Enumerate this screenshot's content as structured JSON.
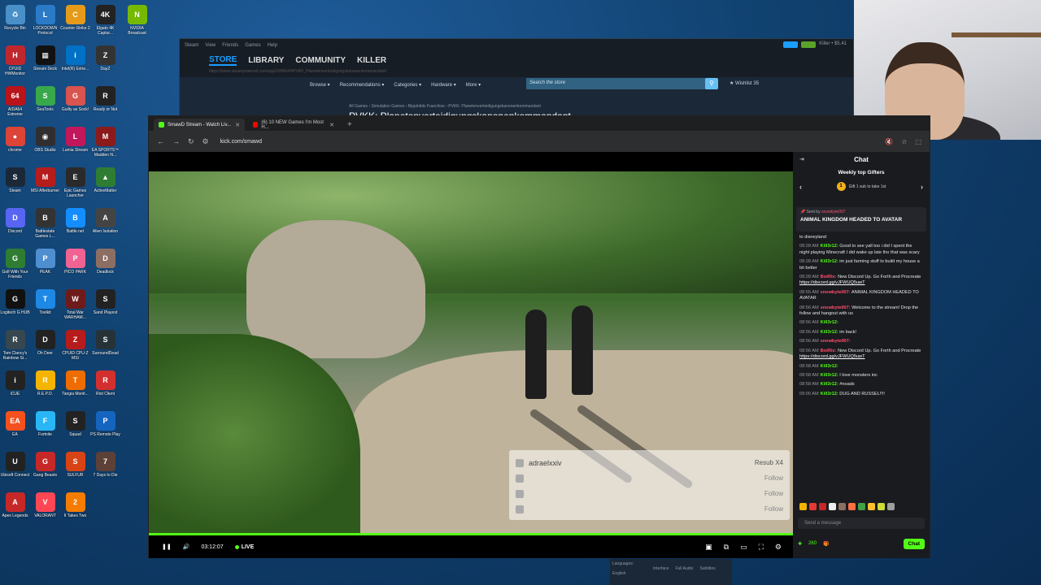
{
  "desktop": {
    "icons": [
      {
        "label": "Recycle Bin",
        "color": "#4a90c8",
        "glyph": "♻"
      },
      {
        "label": "LOCKDOWN Protocol",
        "color": "#2a7ac8",
        "glyph": "L"
      },
      {
        "label": "Counter-Strike 2",
        "color": "#e59a1a",
        "glyph": "C"
      },
      {
        "label": "Elgato 4K Captur...",
        "color": "#222222",
        "glyph": "4K"
      },
      {
        "label": "NVIDIA Broadcast",
        "color": "#76b900",
        "glyph": "N"
      },
      {
        "label": "CPUID HWMonitor",
        "color": "#c0272d",
        "glyph": "H"
      },
      {
        "label": "Stream Deck",
        "color": "#111111",
        "glyph": "▦"
      },
      {
        "label": "Intel(R) Extre...",
        "color": "#0071c5",
        "glyph": "i"
      },
      {
        "label": "DayZ",
        "color": "#333333",
        "glyph": "Z"
      },
      {
        "label": "AIDA64 Extreme",
        "color": "#b8141a",
        "glyph": "64"
      },
      {
        "label": "SeaTools",
        "color": "#38a84a",
        "glyph": "S"
      },
      {
        "label": "Guilty as Sock!",
        "color": "#d9534f",
        "glyph": "G"
      },
      {
        "label": "Ready or Not",
        "color": "#222222",
        "glyph": "R"
      },
      {
        "label": "chrome",
        "color": "#db4437",
        "glyph": "●"
      },
      {
        "label": "OBS Studio",
        "color": "#302e31",
        "glyph": "◉"
      },
      {
        "label": "Lumia Stream",
        "color": "#c2185b",
        "glyph": "L"
      },
      {
        "label": "EA SPORTS™ Madden N...",
        "color": "#8b1a1a",
        "glyph": "M"
      },
      {
        "label": "Steam",
        "color": "#1b2838",
        "glyph": "S"
      },
      {
        "label": "MSI Afterburner",
        "color": "#b71c1c",
        "glyph": "M"
      },
      {
        "label": "Epic Games Launcher",
        "color": "#2a2a2a",
        "glyph": "E"
      },
      {
        "label": "ActiveMatter",
        "color": "#2e7d32",
        "glyph": "▲"
      },
      {
        "label": "Discord",
        "color": "#5865f2",
        "glyph": "D"
      },
      {
        "label": "Battlestate Games L...",
        "color": "#333333",
        "glyph": "B"
      },
      {
        "label": "Battle.net",
        "color": "#148eff",
        "glyph": "B"
      },
      {
        "label": "Alien Isolation",
        "color": "#444444",
        "glyph": "A"
      },
      {
        "label": "Golf With Your Friends",
        "color": "#2e7d32",
        "glyph": "G"
      },
      {
        "label": "PEAK",
        "color": "#4f8fd0",
        "glyph": "P"
      },
      {
        "label": "PICO PARK",
        "color": "#f06292",
        "glyph": "P"
      },
      {
        "label": "Deadlock",
        "color": "#8d6e63",
        "glyph": "D"
      },
      {
        "label": "Logitech G HUB",
        "color": "#111111",
        "glyph": "G"
      },
      {
        "label": "Toolkit",
        "color": "#1e88e5",
        "glyph": "T"
      },
      {
        "label": "Total War WARHAM...",
        "color": "#6d1b1b",
        "glyph": "W"
      },
      {
        "label": "Sand Playest",
        "color": "#222222",
        "glyph": "S"
      },
      {
        "label": "Tom Clancy's Rainbow Si...",
        "color": "#37474f",
        "glyph": "R"
      },
      {
        "label": "Oh Deer",
        "color": "#222222",
        "glyph": "D"
      },
      {
        "label": "CPUID CPU-Z MSI",
        "color": "#b71c1c",
        "glyph": "Z"
      },
      {
        "label": "SurroundDead",
        "color": "#263238",
        "glyph": "S"
      },
      {
        "label": "iCUE",
        "color": "#222222",
        "glyph": "i"
      },
      {
        "label": "R.E.P.O.",
        "color": "#f4b400",
        "glyph": "R"
      },
      {
        "label": "Tangia Monit...",
        "color": "#ef6c00",
        "glyph": "T"
      },
      {
        "label": "Riot Client",
        "color": "#d32f2f",
        "glyph": "R"
      },
      {
        "label": "EA",
        "color": "#f4511e",
        "glyph": "EA"
      },
      {
        "label": "Fortnite",
        "color": "#29b6f6",
        "glyph": "F"
      },
      {
        "label": "Squad",
        "color": "#222222",
        "glyph": "S"
      },
      {
        "label": "PS Remote Play",
        "color": "#1565c0",
        "glyph": "P"
      },
      {
        "label": "Ubisoft Connect",
        "color": "#222222",
        "glyph": "U"
      },
      {
        "label": "Gang Beasts",
        "color": "#c62828",
        "glyph": "G"
      },
      {
        "label": "SULFUR",
        "color": "#d84315",
        "glyph": "S"
      },
      {
        "label": "7 Days to Die",
        "color": "#5d4037",
        "glyph": "7"
      },
      {
        "label": "Apex Legends",
        "color": "#c62828",
        "glyph": "A"
      },
      {
        "label": "VALORANT",
        "color": "#ff4655",
        "glyph": "V"
      },
      {
        "label": "It Takes Two",
        "color": "#f57c00",
        "glyph": "2"
      }
    ]
  },
  "steam": {
    "menu": [
      "Steam",
      "View",
      "Friends",
      "Games",
      "Help"
    ],
    "nav": [
      "STORE",
      "LIBRARY",
      "COMMUNITY",
      "KILLER"
    ],
    "url": "https://store.steampowered.com/app/2956040/PVKK_Planetenverteidigungskanonenkommandant/",
    "store_menu": [
      "Browse ▾",
      "Recommendations ▾",
      "Categories ▾",
      "Hardware ▾",
      "More ▾"
    ],
    "search_placeholder": "Search the store",
    "wishlist": "Wishlist 35",
    "breadcrumb": "All Games › Simulation Games › Bippinbits Franchise › PVKK: Planetenverteidigungskanonenkommandant",
    "game_title": "PVKK: Planetenverteidigungskanonenkommandant",
    "user": "Killer • $5.41"
  },
  "browser": {
    "tabs": [
      {
        "label": "SmawD Stream - Watch Liv...",
        "favicon_color": "#53fc18"
      },
      {
        "label": "(6) 10 NEW Games I'm Most H...",
        "favicon_color": "#ff0000"
      }
    ],
    "url": "kick.com/smawd"
  },
  "player": {
    "time": "03:12:07",
    "live_label": "LIVE",
    "overlay": {
      "top_user": "adraelxxiv",
      "top_action": "Resub X4",
      "rows": [
        {
          "name": "",
          "action": "Follow"
        },
        {
          "name": "",
          "action": "Follow"
        },
        {
          "name": "",
          "action": "Follow"
        }
      ]
    }
  },
  "chat": {
    "title": "Chat",
    "top_gifters_title": "Weekly top Gifters",
    "gift_prompt": "Gift 1 sub to take 1st",
    "pinned_by": "Sent by",
    "pinned_user": "snowbyte007",
    "pinned_message": "ANIMAL KINGDOM HEADED TO AVATAR",
    "partial_line": "to disneyland",
    "messages": [
      {
        "time": "08:28 AM",
        "user": "Kill3r12:",
        "user_color": "#53fc18",
        "text": "Good to see yall too i did I spent the night playing Minecraft I did wake up late tho that was scary",
        "link": ""
      },
      {
        "time": "08:28 AM",
        "user": "Kill3r12:",
        "user_color": "#53fc18",
        "text": "im just farming stuff to build my house a bit better",
        "link": ""
      },
      {
        "time": "08:28 AM",
        "user": "BotRix:",
        "user_color": "#ff4f6e",
        "text": "New Discord Up. Go Forth and Procreate",
        "link": "https://discord.gg/vJFWUQ5uwT"
      },
      {
        "time": "08:55 AM",
        "user": "snowbyte007:",
        "user_color": "#ff4f6e",
        "text": "ANIMAL KINGDOM HEADED TO AVATAR",
        "link": ""
      },
      {
        "time": "08:56 AM",
        "user": "snowbyte007:",
        "user_color": "#ff4f6e",
        "text": "Welcome to the stream! Drop the follow and hangout with us",
        "link": ""
      },
      {
        "time": "08:56 AM",
        "user": "Kill3r12:",
        "user_color": "#53fc18",
        "text": "",
        "link": ""
      },
      {
        "time": "08:56 AM",
        "user": "Kill3r12:",
        "user_color": "#53fc18",
        "text": "im back!",
        "link": ""
      },
      {
        "time": "08:56 AM",
        "user": "snowbyte007:",
        "user_color": "#ff4f6e",
        "text": "",
        "link": ""
      },
      {
        "time": "08:56 AM",
        "user": "BotRix:",
        "user_color": "#ff4f6e",
        "text": "New Discord Up. Go Forth and Procreate",
        "link": "https://discord.gg/vJFWUQ5uwT"
      },
      {
        "time": "08:58 AM",
        "user": "Kill3r12:",
        "user_color": "#53fc18",
        "text": "",
        "link": ""
      },
      {
        "time": "08:58 AM",
        "user": "Kill3r12:",
        "user_color": "#53fc18",
        "text": "I love monsters inc",
        "link": ""
      },
      {
        "time": "08:58 AM",
        "user": "Kill3r12:",
        "user_color": "#53fc18",
        "text": "#noads",
        "link": ""
      },
      {
        "time": "09:00 AM",
        "user": "Kill3r12:",
        "user_color": "#53fc18",
        "text": "DUG AND RUSSEL!!!!",
        "link": ""
      }
    ],
    "input_placeholder": "Send a message",
    "points": "260",
    "chat_button": "Chat"
  },
  "steam_lang": {
    "title": "Languages:",
    "cols": [
      "Interface",
      "Full Audio",
      "Subtitles"
    ],
    "row": "English"
  },
  "colors": {
    "kick_green": "#53fc18",
    "steam_blue": "#1a9fff"
  }
}
